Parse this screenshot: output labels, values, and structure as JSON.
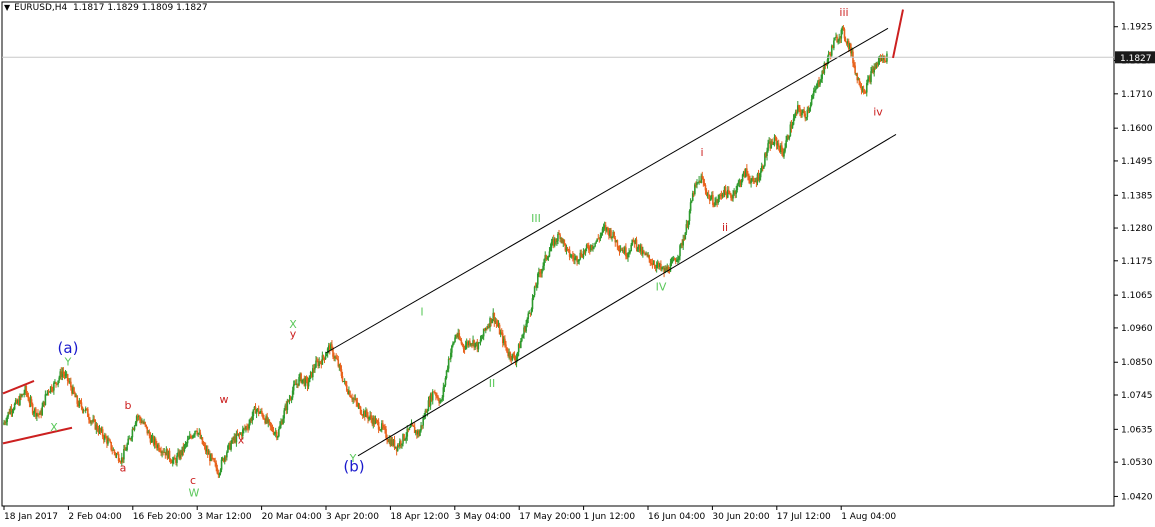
{
  "header": {
    "symbol": "EURUSD,H4",
    "ohlc": "1.1817 1.1829 1.1809 1.1827"
  },
  "colors": {
    "up_candle": "#2e9a2e",
    "down_candle": "#e8621c",
    "wave_green": "#5ac85a",
    "wave_red": "#cc2020",
    "wave_blue": "#1a1acc",
    "channel": "#000000",
    "price_badge_bg": "#1a1a1a"
  },
  "chart_data": {
    "type": "line",
    "title": "EURUSD,H4",
    "ylim": [
      1.0415,
      1.1985
    ],
    "y_ticks": [
      "1.1925",
      "1.1817",
      "1.1710",
      "1.1600",
      "1.1495",
      "1.1385",
      "1.1280",
      "1.1175",
      "1.1065",
      "1.0960",
      "1.0850",
      "1.0745",
      "1.0635",
      "1.0530",
      "1.0420"
    ],
    "x_ticks": [
      "18 Jan 2017",
      "2 Feb 04:00",
      "16 Feb 20:00",
      "3 Mar 12:00",
      "20 Mar 04:00",
      "3 Apr 20:00",
      "18 Apr 12:00",
      "3 May 04:00",
      "17 May 20:00",
      "1 Jun 12:00",
      "16 Jun 04:00",
      "30 Jun 20:00",
      "17 Jul 12:00",
      "1 Aug 04:00"
    ],
    "current_price": "1.1827",
    "series": [
      {
        "values": [
          1.065,
          1.07,
          1.072,
          1.076,
          1.07,
          1.068,
          1.076,
          1.078,
          1.082,
          1.078,
          1.072,
          1.07,
          1.066,
          1.063,
          1.06,
          1.056,
          1.054,
          1.06,
          1.068,
          1.065,
          1.06,
          1.058,
          1.056,
          1.053,
          1.056,
          1.06,
          1.064,
          1.058,
          1.054,
          1.05,
          1.056,
          1.06,
          1.062,
          1.065,
          1.07,
          1.068,
          1.064,
          1.062,
          1.07,
          1.076,
          1.08,
          1.078,
          1.084,
          1.086,
          1.09,
          1.085,
          1.078,
          1.074,
          1.07,
          1.068,
          1.066,
          1.064,
          1.06,
          1.058,
          1.061,
          1.064,
          1.062,
          1.07,
          1.076,
          1.072,
          1.086,
          1.094,
          1.09,
          1.092,
          1.09,
          1.096,
          1.1,
          1.094,
          1.088,
          1.086,
          1.094,
          1.102,
          1.112,
          1.118,
          1.123,
          1.126,
          1.12,
          1.118,
          1.12,
          1.122,
          1.124,
          1.128,
          1.126,
          1.122,
          1.12,
          1.124,
          1.12,
          1.118,
          1.116,
          1.114,
          1.116,
          1.12,
          1.128,
          1.14,
          1.144,
          1.138,
          1.136,
          1.14,
          1.138,
          1.142,
          1.146,
          1.142,
          1.146,
          1.154,
          1.156,
          1.152,
          1.16,
          1.166,
          1.164,
          1.17,
          1.176,
          1.182,
          1.188,
          1.191,
          1.186,
          1.176,
          1.172,
          1.178,
          1.182,
          1.1827
        ]
      }
    ],
    "channels": [
      {
        "from": [
          "3 Apr 20:00",
          1.088
        ],
        "to": [
          "1 Aug 04:00",
          1.192
        ]
      },
      {
        "from": [
          "3 Apr 20:00",
          1.055
        ],
        "to": [
          "1 Aug 04:00",
          1.158
        ]
      }
    ],
    "wave_labels": [
      {
        "text": "(a)",
        "color": "blue",
        "price": 1.088,
        "at": "2 Feb 04:00"
      },
      {
        "text": "(b)",
        "color": "blue",
        "price": 1.05,
        "at": "3 Apr 20:00"
      },
      {
        "text": "Y",
        "color": "green",
        "price": 1.084
      },
      {
        "text": "X",
        "color": "green",
        "price": 1.063
      },
      {
        "text": "b",
        "color": "red",
        "price": 1.07
      },
      {
        "text": "a",
        "color": "red",
        "price": 1.05
      },
      {
        "text": "c",
        "color": "red",
        "price": 1.046
      },
      {
        "text": "W",
        "color": "green",
        "price": 1.042
      },
      {
        "text": "w",
        "color": "red",
        "price": 1.072
      },
      {
        "text": "x",
        "color": "red",
        "price": 1.059
      },
      {
        "text": "X",
        "color": "green",
        "price": 1.096
      },
      {
        "text": "y",
        "color": "red",
        "price": 1.093
      },
      {
        "text": "Y",
        "color": "green",
        "price": 1.053
      },
      {
        "text": "I",
        "color": "green",
        "price": 1.1
      },
      {
        "text": "II",
        "color": "green",
        "price": 1.077
      },
      {
        "text": "III",
        "color": "green",
        "price": 1.13
      },
      {
        "text": "IV",
        "color": "green",
        "price": 1.108
      },
      {
        "text": "i",
        "color": "red",
        "price": 1.151
      },
      {
        "text": "ii",
        "color": "red",
        "price": 1.127
      },
      {
        "text": "iii",
        "color": "red",
        "price": 1.196
      },
      {
        "text": "iv",
        "color": "red",
        "price": 1.164
      }
    ]
  }
}
